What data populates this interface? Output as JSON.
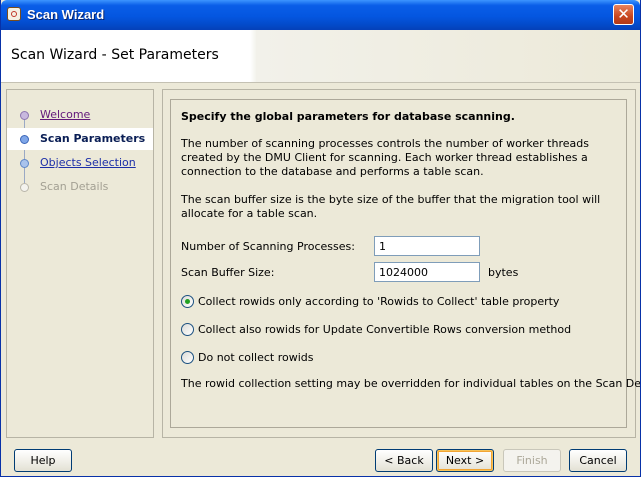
{
  "window": {
    "title": "Scan Wizard",
    "close_glyph": "✕"
  },
  "banner": {
    "title": "Scan Wizard - Set Parameters"
  },
  "nav": {
    "items": [
      {
        "label": "Welcome",
        "state": "visited"
      },
      {
        "label": "Scan Parameters",
        "state": "current"
      },
      {
        "label": "Objects Selection",
        "state": "link"
      },
      {
        "label": "Scan Details",
        "state": "disabled"
      }
    ]
  },
  "content": {
    "heading": "Specify the global parameters for database scanning.",
    "para1": "The number of scanning processes controls the number of worker threads created by the DMU Client for scanning. Each worker thread establishes a connection to the database and performs a table scan.",
    "para2": "The scan buffer size is the byte size of the buffer that the migration tool will allocate for a table scan.",
    "fields": {
      "processes": {
        "label": "Number of Scanning Processes:",
        "value": "1"
      },
      "buffer": {
        "label": "Scan Buffer Size:",
        "value": "1024000",
        "units": "bytes"
      }
    },
    "radios": [
      {
        "label": "Collect rowids only according to 'Rowids to Collect' table property",
        "checked": true
      },
      {
        "label": "Collect also rowids for Update Convertible Rows conversion method",
        "checked": false
      },
      {
        "label": "Do not collect rowids",
        "checked": false
      }
    ],
    "note": "The rowid collection setting may be overridden for individual tables on the Scan Details page."
  },
  "buttons": {
    "help": "Help",
    "back": "Back",
    "next": "Next >",
    "finish": "Finish",
    "cancel": "Cancel"
  },
  "icons": {
    "app": "app-wizard-icon",
    "close": "close-icon"
  },
  "colors": {
    "title_bar": "#0456e0",
    "visited_link": "#62177a",
    "link": "#1c2fa8",
    "default_button_highlight": "#f2a534"
  }
}
